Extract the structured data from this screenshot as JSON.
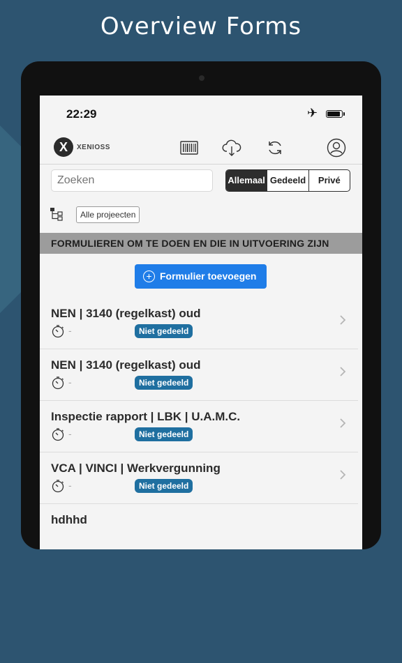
{
  "headline": "Overview Forms",
  "status": {
    "time": "22:29"
  },
  "toolbar": {
    "logo_mark": "X",
    "logo_text": "XENIOSS",
    "icons": [
      "barcode-icon",
      "cloud-download-icon",
      "sync-icon",
      "user-icon"
    ]
  },
  "search": {
    "placeholder": "Zoeken",
    "value": ""
  },
  "filter_segments": [
    "Allemaal",
    "Gedeeld",
    "Privé"
  ],
  "filter_selected": "Allemaal",
  "projects_button": "Alle projeecten",
  "section_title": "FORMULIEREN OM TE DOEN EN DIE IN UITVOERING ZIJN",
  "add_button": "Formulier toevoegen",
  "forms": [
    {
      "title": "NEN | 3140 (regelkast) oud",
      "time": "-",
      "badge": "Niet gedeeld"
    },
    {
      "title": "NEN | 3140 (regelkast) oud",
      "time": "-",
      "badge": "Niet gedeeld"
    },
    {
      "title": "Inspectie rapport | LBK | U.A.M.C.",
      "time": "-",
      "badge": "Niet gedeeld"
    },
    {
      "title": "VCA | VINCI | Werkvergunning",
      "time": "-",
      "badge": "Niet gedeeld"
    },
    {
      "title": "hdhhd"
    }
  ],
  "colors": {
    "background": "#2d5470",
    "accent_button": "#1f7de8",
    "badge": "#1f6fa0",
    "section_bar": "#9c9c9c"
  }
}
